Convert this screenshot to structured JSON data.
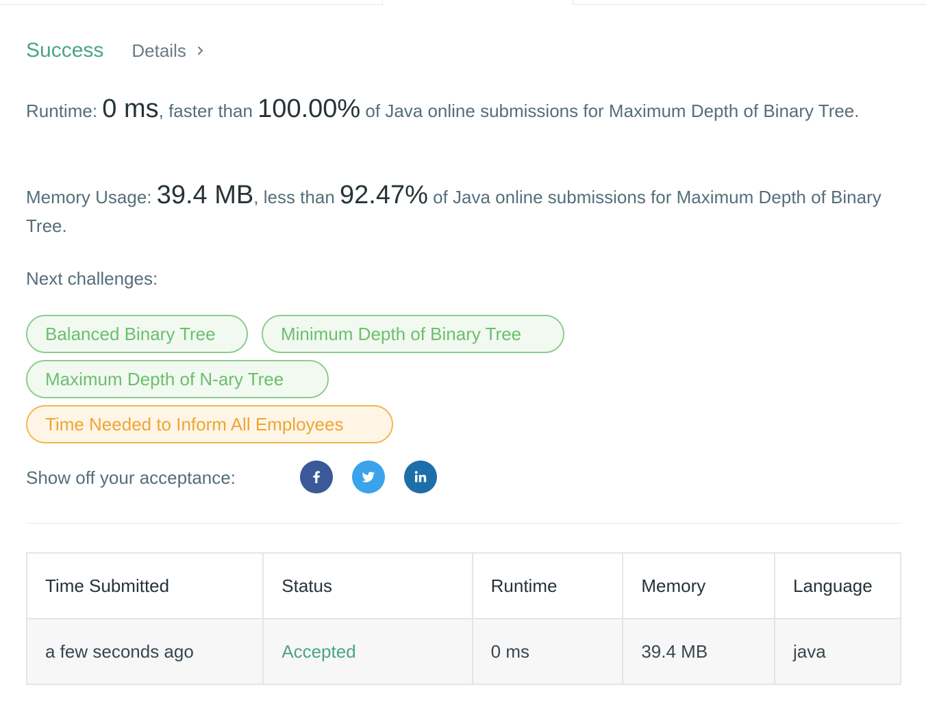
{
  "result": {
    "status": "Success",
    "details_label": "Details"
  },
  "runtime": {
    "label": "Runtime:",
    "value": "0 ms",
    "comparison": ", faster than ",
    "percent": "100.00%",
    "suffix": " of Java online submissions for Maximum Depth of Binary Tree."
  },
  "memory": {
    "label": "Memory Usage:",
    "value": "39.4 MB",
    "comparison": ", less than ",
    "percent": "92.47%",
    "suffix": " of Java online submissions for Maximum Depth of Binary Tree."
  },
  "next": {
    "label": "Next challenges:",
    "challenges": [
      {
        "title": "Balanced Binary Tree",
        "difficulty_color": "green"
      },
      {
        "title": "Minimum Depth of Binary Tree",
        "difficulty_color": "green"
      },
      {
        "title": "Maximum Depth of N-ary Tree",
        "difficulty_color": "green"
      },
      {
        "title": "Time Needed to Inform All Employees",
        "difficulty_color": "orange"
      }
    ]
  },
  "share": {
    "label": "Show off your acceptance:",
    "icons": [
      "facebook-icon",
      "twitter-icon",
      "linkedin-icon"
    ]
  },
  "submissions": {
    "headers": [
      "Time Submitted",
      "Status",
      "Runtime",
      "Memory",
      "Language"
    ],
    "rows": [
      [
        "a few seconds ago",
        "Accepted",
        "0 ms",
        "39.4 MB",
        "java"
      ]
    ]
  },
  "colors": {
    "success": "#4aa388",
    "green_chip": "#6bbf6b",
    "orange_chip": "#efa531",
    "facebook": "#3b5998",
    "twitter": "#3aa3ec",
    "linkedin": "#1d6faa"
  }
}
